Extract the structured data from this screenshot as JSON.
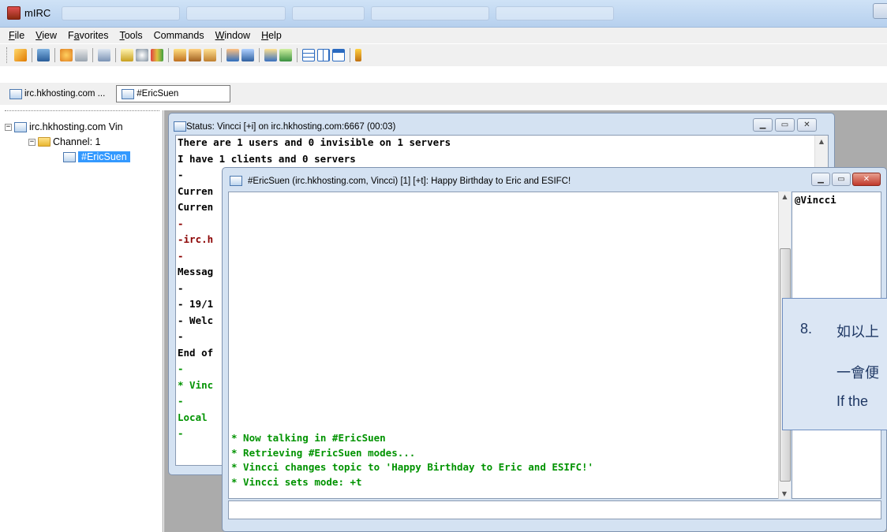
{
  "window": {
    "title": "mIRC"
  },
  "menu": [
    {
      "label": "File",
      "key": "F"
    },
    {
      "label": "View",
      "key": "V"
    },
    {
      "label": "Favorites",
      "key": "a"
    },
    {
      "label": "Tools",
      "key": "T"
    },
    {
      "label": "Commands",
      "key": ""
    },
    {
      "label": "Window",
      "key": "W"
    },
    {
      "label": "Help",
      "key": "H"
    }
  ],
  "switchbar": {
    "server": "irc.hkhosting.com ...",
    "channel": "#EricSuen"
  },
  "treebar": {
    "server": "irc.hkhosting.com Vin",
    "group": "Channel: 1",
    "channel": "#EricSuen"
  },
  "status_window": {
    "title": "Status: Vincci [+i] on irc.hkhosting.com:6667 (00:03)",
    "lines": [
      {
        "text": "There are 1 users and 0 invisible on 1 servers",
        "color": "#000000"
      },
      {
        "text": "I have 1 clients and 0 servers",
        "color": "#000000"
      },
      {
        "text": "-",
        "color": "#000000"
      },
      {
        "text": "Curren",
        "color": "#000000"
      },
      {
        "text": "Curren",
        "color": "#000000"
      },
      {
        "text": "-",
        "color": "#8b0000"
      },
      {
        "text": "-irc.h",
        "color": "#8b0000"
      },
      {
        "text": "-",
        "color": "#8b0000"
      },
      {
        "text": "Messag",
        "color": "#000000"
      },
      {
        "text": "-",
        "color": "#000000"
      },
      {
        "text": "- 19/1",
        "color": "#000000"
      },
      {
        "text": "- Welc",
        "color": "#000000"
      },
      {
        "text": "-",
        "color": "#000000"
      },
      {
        "text": "End of",
        "color": "#000000"
      },
      {
        "text": "-",
        "color": "#009300"
      },
      {
        "text": "* Vinc",
        "color": "#009300"
      },
      {
        "text": "-",
        "color": "#009300"
      },
      {
        "text": "Local",
        "color": "#009300"
      },
      {
        "text": "-",
        "color": "#009300"
      }
    ]
  },
  "channel_window": {
    "title": "#EricSuen (irc.hkhosting.com, Vincci) [1] [+t]: Happy Birthday to Eric and ESIFC!",
    "lines": [
      "* Now talking in #EricSuen",
      "* Retrieving #EricSuen modes...",
      "* Vincci changes topic to 'Happy Birthday to Eric and ESIFC!'",
      "* Vincci sets mode: +t"
    ],
    "nicklist": [
      "@Vincci"
    ]
  },
  "overlay": {
    "number": "8.",
    "line1": "如以上",
    "line2": "一會便",
    "line3": "If the"
  }
}
